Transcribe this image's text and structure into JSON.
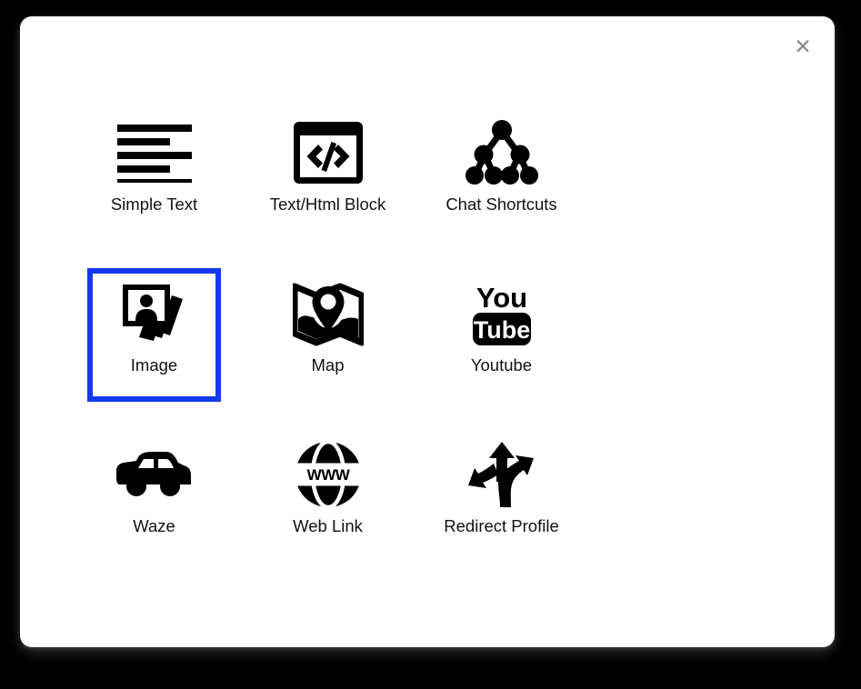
{
  "theme": {
    "backdrop_color": "#000000",
    "modal_background": "#ffffff",
    "selection_color": "#1539f0",
    "icon_color": "#000000",
    "label_color": "#121212",
    "close_icon_color": "#8a8a8a"
  },
  "modal": {
    "close_icon": "close-icon",
    "close_glyph": "✕",
    "selected_item": "Image"
  },
  "grid": {
    "columns": 3,
    "rows": 3,
    "items": [
      {
        "label": "Simple Text",
        "icon": "text-lines-icon",
        "selected": false
      },
      {
        "label": "Text/Html Block",
        "icon": "code-window-icon",
        "selected": false
      },
      {
        "label": "Chat Shortcuts",
        "icon": "node-tree-icon",
        "selected": false
      },
      {
        "label": "Image",
        "icon": "photo-stack-icon",
        "selected": true
      },
      {
        "label": "Map",
        "icon": "map-pin-icon",
        "selected": false
      },
      {
        "label": "Youtube",
        "icon": "youtube-logo-icon",
        "selected": false
      },
      {
        "label": "Waze",
        "icon": "car-icon",
        "selected": false
      },
      {
        "label": "Web Link",
        "icon": "globe-www-icon",
        "selected": false
      },
      {
        "label": "Redirect Profile",
        "icon": "three-way-arrows-icon",
        "selected": false
      }
    ]
  },
  "youtube_logo": {
    "top_text": "You",
    "bottom_text": "Tube"
  },
  "globe_icon": {
    "text": "WWW"
  }
}
